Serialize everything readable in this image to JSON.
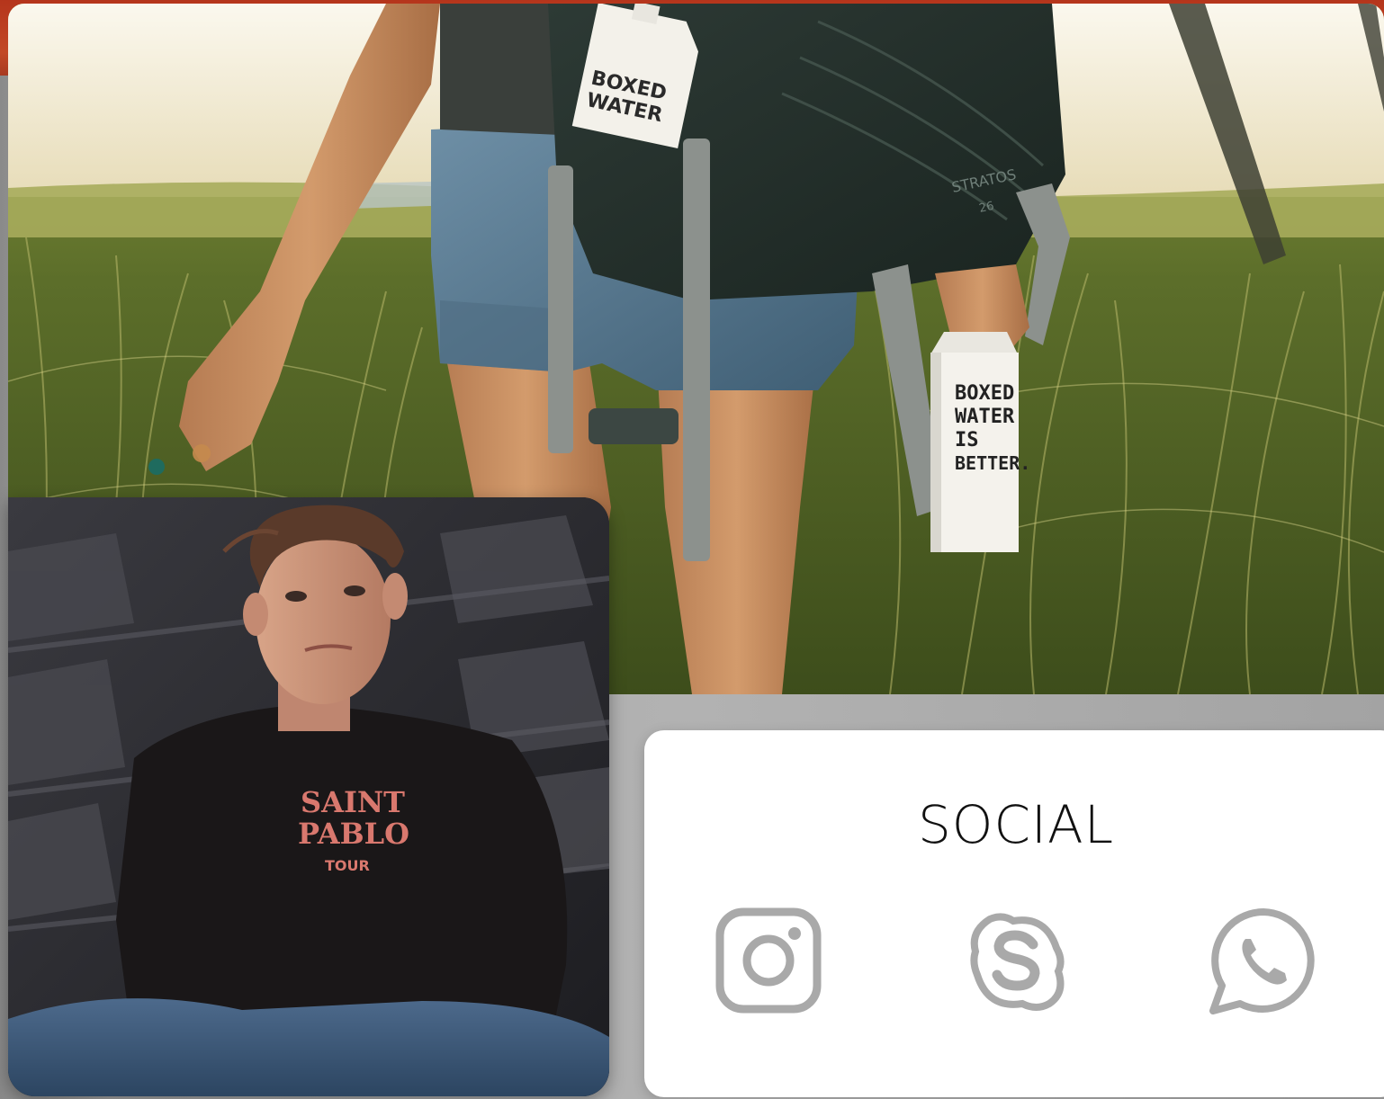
{
  "social": {
    "title": "SOCIAL",
    "icon_color": "#a9a9a9",
    "icons": [
      {
        "name": "instagram-icon"
      },
      {
        "name": "skype-icon"
      },
      {
        "name": "whatsapp-icon"
      }
    ]
  },
  "hero_photo": {
    "carton_text_lines": [
      "BOXED",
      "WATER",
      "IS",
      "BETTER."
    ],
    "bottle_text_lines": [
      "BOXED",
      "WATER"
    ],
    "backpack_text": "STRATOS",
    "backpack_size": "26"
  },
  "portrait_photo": {
    "shirt_text_lines": [
      "SAINT",
      "PABLO",
      "TOUR"
    ]
  },
  "colors": {
    "top_band": "#b5351c",
    "panel": "#b2b2b2",
    "card": "#ffffff"
  }
}
